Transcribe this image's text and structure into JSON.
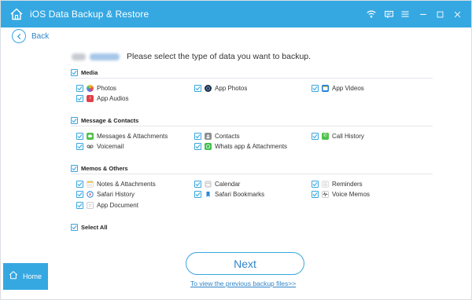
{
  "titlebar": {
    "title": "iOS Data Backup & Restore",
    "color": "#35a8e2",
    "icons": [
      "home-icon",
      "wifi-icon",
      "feedback-icon",
      "menu-icon",
      "minimize-icon",
      "restore-icon",
      "close-icon"
    ]
  },
  "back": {
    "label": "Back"
  },
  "device": {
    "prompt": "Please select the type of data you want to backup."
  },
  "sections": {
    "media": {
      "title": "Media",
      "items": [
        {
          "label": "Photos",
          "icon": "photos-icon",
          "checked": true
        },
        {
          "label": "App Photos",
          "icon": "app-photos-icon",
          "checked": true
        },
        {
          "label": "App Videos",
          "icon": "app-videos-icon",
          "checked": true
        },
        {
          "label": "App Audios",
          "icon": "app-audios-icon",
          "checked": true
        }
      ]
    },
    "messages": {
      "title": "Message & Contacts",
      "items": [
        {
          "label": "Messages & Attachments",
          "icon": "messages-icon",
          "checked": true
        },
        {
          "label": "Contacts",
          "icon": "contacts-icon",
          "checked": true
        },
        {
          "label": "Call History",
          "icon": "call-history-icon",
          "checked": true
        },
        {
          "label": "Voicemail",
          "icon": "voicemail-icon",
          "checked": true
        },
        {
          "label": "Whats app & Attachments",
          "icon": "whatsapp-icon",
          "checked": true
        }
      ]
    },
    "memos": {
      "title": "Memos & Others",
      "items": [
        {
          "label": "Notes & Attachments",
          "icon": "notes-icon",
          "checked": true
        },
        {
          "label": "Calendar",
          "icon": "calendar-icon",
          "checked": true
        },
        {
          "label": "Reminders",
          "icon": "reminders-icon",
          "checked": true
        },
        {
          "label": "Safari History",
          "icon": "safari-history-icon",
          "checked": true
        },
        {
          "label": "Safari Bookmarks",
          "icon": "safari-bookmarks-icon",
          "checked": true
        },
        {
          "label": "Voice Memos",
          "icon": "voice-memos-icon",
          "checked": true
        },
        {
          "label": "App Document",
          "icon": "app-document-icon",
          "checked": true
        }
      ]
    }
  },
  "select_all": {
    "label": "Select All",
    "checked": true
  },
  "sidebar": {
    "home_label": "Home"
  },
  "footer": {
    "next_label": "Next",
    "previous_link": "To view the previous backup files>>"
  },
  "colors": {
    "accent": "#35a8e2",
    "link": "#2f84c7",
    "checkbox_border": "#3aa6df"
  }
}
